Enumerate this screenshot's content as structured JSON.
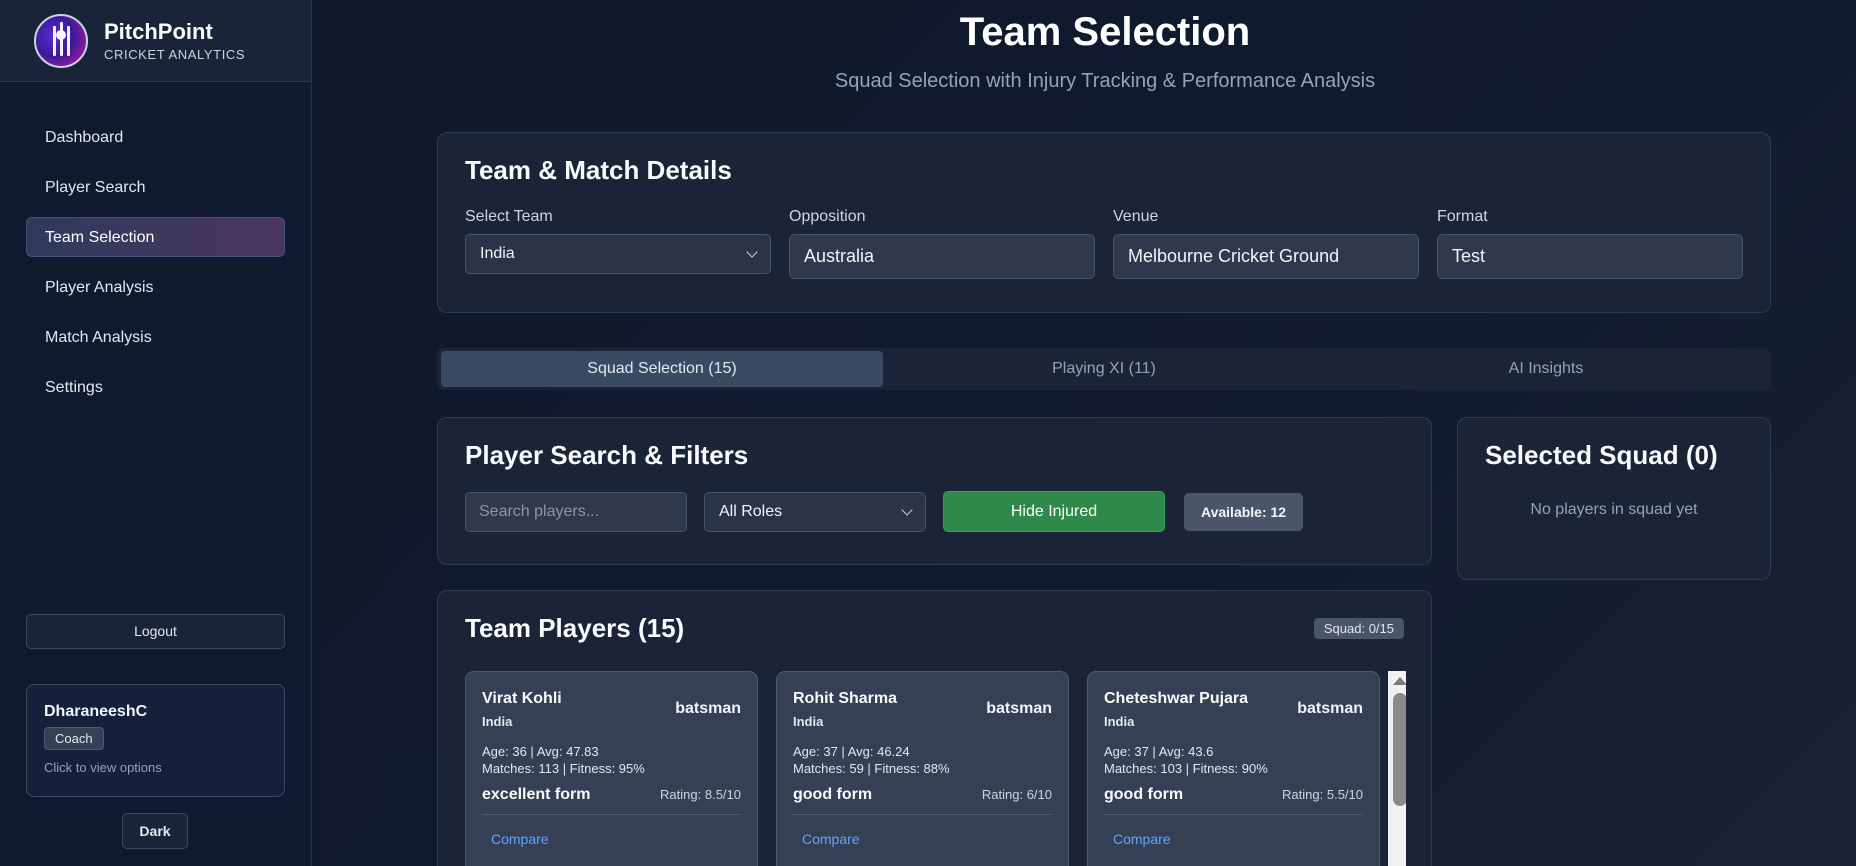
{
  "brand": {
    "name": "PitchPoint",
    "subtitle": "CRICKET ANALYTICS"
  },
  "sidebar": {
    "items": [
      {
        "label": "Dashboard",
        "active": false
      },
      {
        "label": "Player Search",
        "active": false
      },
      {
        "label": "Team Selection",
        "active": true
      },
      {
        "label": "Player Analysis",
        "active": false
      },
      {
        "label": "Match Analysis",
        "active": false
      },
      {
        "label": "Settings",
        "active": false
      }
    ],
    "logout_label": "Logout",
    "user": {
      "name": "DharaneeshC",
      "role": "Coach",
      "hint": "Click to view options"
    },
    "theme_label": "Dark"
  },
  "header": {
    "title": "Team Selection",
    "subtitle": "Squad Selection with Injury Tracking & Performance Analysis"
  },
  "details": {
    "title": "Team & Match Details",
    "team": {
      "label": "Select Team",
      "value": "India"
    },
    "opposition": {
      "label": "Opposition",
      "value": "Australia"
    },
    "venue": {
      "label": "Venue",
      "value": "Melbourne Cricket Ground"
    },
    "format": {
      "label": "Format",
      "value": "Test"
    }
  },
  "tabs": [
    {
      "label": "Squad Selection (15)",
      "active": true
    },
    {
      "label": "Playing XI (11)",
      "active": false
    },
    {
      "label": "AI Insights",
      "active": false
    }
  ],
  "filters": {
    "title": "Player Search & Filters",
    "search_placeholder": "Search players...",
    "role_value": "All Roles",
    "hide_injured_label": "Hide Injured",
    "available_label": "Available: 12"
  },
  "squad": {
    "title": "Selected Squad (0)",
    "empty_text": "No players in squad yet"
  },
  "players": {
    "title": "Team Players (15)",
    "squad_count": "Squad: 0/15",
    "list": [
      {
        "name": "Virat Kohli",
        "team": "India",
        "role": "batsman",
        "stats_line1": "Age: 36 | Avg: 47.83",
        "stats_line2": "Matches: 113 | Fitness: 95%",
        "form": "excellent form",
        "rating": "Rating: 8.5/10",
        "compare": "Compare"
      },
      {
        "name": "Rohit Sharma",
        "team": "India",
        "role": "batsman",
        "stats_line1": "Age: 37 | Avg: 46.24",
        "stats_line2": "Matches: 59 | Fitness: 88%",
        "form": "good form",
        "rating": "Rating: 6/10",
        "compare": "Compare"
      },
      {
        "name": "Cheteshwar Pujara",
        "team": "India",
        "role": "batsman",
        "stats_line1": "Age: 37 | Avg: 43.6",
        "stats_line2": "Matches: 103 | Fitness: 90%",
        "form": "good form",
        "rating": "Rating: 5.5/10",
        "compare": "Compare"
      }
    ]
  },
  "colors": {
    "accent_green": "#2f8a4a",
    "link_blue": "#60a5fa",
    "background": "#0f172a"
  }
}
